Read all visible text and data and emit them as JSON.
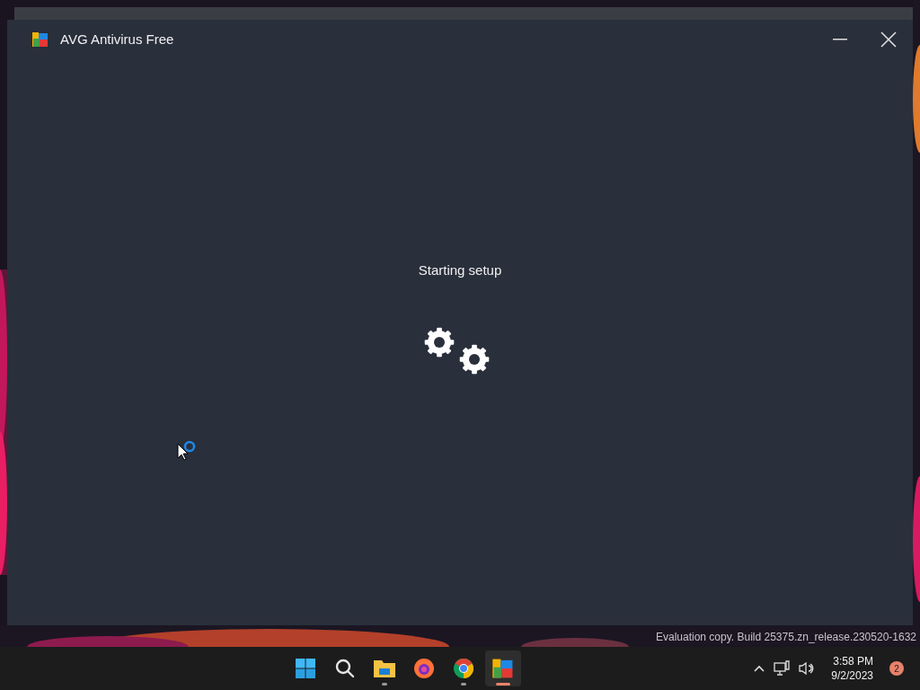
{
  "window": {
    "title": "AVG Antivirus Free",
    "message": "Starting setup"
  },
  "desktop": {
    "watermark": "Evaluation copy. Build 25375.zn_release.230520-1632"
  },
  "taskbar": {
    "apps": [
      {
        "kind": "start",
        "running": false,
        "selected": false
      },
      {
        "kind": "search",
        "running": false,
        "selected": false
      },
      {
        "kind": "folder",
        "running": true,
        "selected": false
      },
      {
        "kind": "firefox",
        "running": false,
        "selected": false
      },
      {
        "kind": "chrome",
        "running": true,
        "selected": false
      },
      {
        "kind": "avg",
        "running": true,
        "selected": true
      }
    ],
    "clock": {
      "time": "3:58 PM",
      "date": "9/2/2023"
    },
    "notifications": "2"
  }
}
